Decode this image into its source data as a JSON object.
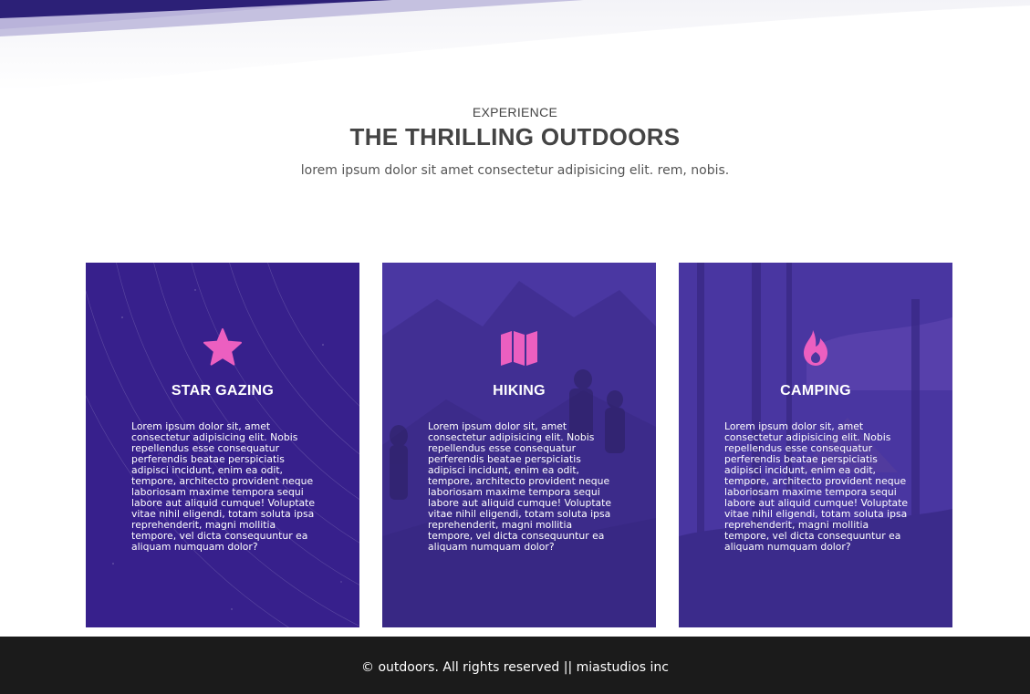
{
  "section": {
    "eyebrow": "EXPERIENCE",
    "title": "THE THRILLING OUTDOORS",
    "subtitle": "lorem ipsum dolor sit amet consectetur adipisicing elit. rem, nobis."
  },
  "colors": {
    "accent": "#ec5fc0",
    "card_overlay": "#3d2592",
    "footer_bg": "#1b1b1b",
    "wave": "#2c2077"
  },
  "cards": [
    {
      "title": "STAR GAZING",
      "icon": "star-icon",
      "text": "Lorem ipsum dolor sit, amet consectetur adipisicing elit. Nobis repellendus esse consequatur perferendis beatae perspiciatis adipisci incidunt, enim ea odit, tempore, architecto provident neque laboriosam maxime tempora sequi labore aut aliquid cumque! Voluptate vitae nihil eligendi, totam soluta ipsa reprehenderit, magni mollitia tempore, vel dicta consequuntur ea aliquam numquam dolor?"
    },
    {
      "title": "HIKING",
      "icon": "map-icon",
      "text": "Lorem ipsum dolor sit, amet consectetur adipisicing elit. Nobis repellendus esse consequatur perferendis beatae perspiciatis adipisci incidunt, enim ea odit, tempore, architecto provident neque laboriosam maxime tempora sequi labore aut aliquid cumque! Voluptate vitae nihil eligendi, totam soluta ipsa reprehenderit, magni mollitia tempore, vel dicta consequuntur ea aliquam numquam dolor?"
    },
    {
      "title": "CAMPING",
      "icon": "fire-icon",
      "text": "Lorem ipsum dolor sit, amet consectetur adipisicing elit. Nobis repellendus esse consequatur perferendis beatae perspiciatis adipisci incidunt, enim ea odit, tempore, architecto provident neque laboriosam maxime tempora sequi labore aut aliquid cumque! Voluptate vitae nihil eligendi, totam soluta ipsa reprehenderit, magni mollitia tempore, vel dicta consequuntur ea aliquam numquam dolor?"
    }
  ],
  "footer": {
    "text": "© outdoors. All rights reserved || miastudios inc"
  }
}
